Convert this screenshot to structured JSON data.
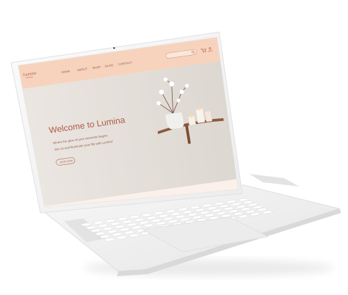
{
  "site": {
    "logo": "Lumina",
    "logo_tagline": "CANDLES",
    "nav": [
      "HOME",
      "ABOUT",
      "SHOP",
      "BLOG",
      "CONTACT"
    ],
    "search_placeholder": "",
    "hero_title": "Welcome to Lumina",
    "hero_line1": "Where the glow of your moments begins.",
    "hero_line2": "Join us and illuminate your life with Lumina!",
    "cta_label": "SHOP NOW"
  },
  "colors": {
    "header_bg": "#f7d3bd",
    "accent": "#b05a47",
    "hero_bg": "#e7e2dd",
    "device": "#f4f4f4"
  },
  "icons": [
    "search-icon",
    "cart-icon",
    "user-icon",
    "webcam-icon",
    "speaker-grille-icon",
    "trackpad-icon"
  ]
}
